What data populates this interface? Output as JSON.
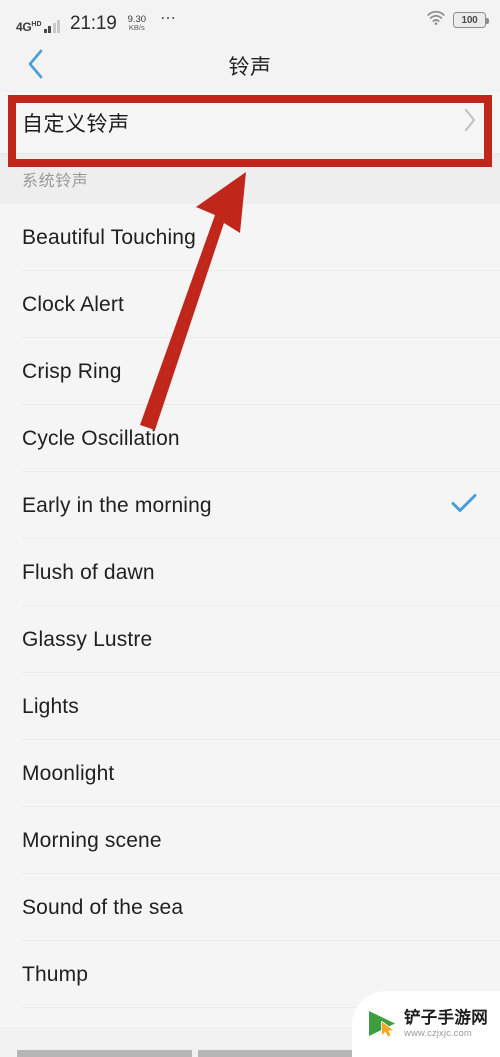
{
  "status_bar": {
    "network_type": "4G",
    "network_hd": "HD",
    "time": "21:19",
    "net_speed_value": "9.30",
    "net_speed_unit": "KB/s",
    "overflow_icon": "more-dots-icon",
    "wifi_icon": "wifi-icon",
    "battery_level": "100"
  },
  "header": {
    "back_icon": "chevron-left-icon",
    "title": "铃声"
  },
  "custom_ringtone": {
    "label": "自定义铃声",
    "chevron_icon": "chevron-right-icon"
  },
  "section": {
    "title": "系统铃声"
  },
  "ringtones": [
    {
      "name": "Beautiful Touching",
      "selected": false
    },
    {
      "name": "Clock Alert",
      "selected": false
    },
    {
      "name": "Crisp Ring",
      "selected": false
    },
    {
      "name": "Cycle Oscillation",
      "selected": false
    },
    {
      "name": "Early in the morning",
      "selected": true
    },
    {
      "name": "Flush of dawn",
      "selected": false
    },
    {
      "name": "Glassy Lustre",
      "selected": false
    },
    {
      "name": "Lights",
      "selected": false
    },
    {
      "name": "Moonlight",
      "selected": false
    },
    {
      "name": "Morning scene",
      "selected": false
    },
    {
      "name": "Sound of the sea",
      "selected": false
    },
    {
      "name": "Thump",
      "selected": false
    }
  ],
  "annotations": {
    "highlight_box_color": "#c0271a",
    "arrow_color": "#c0271a",
    "arrow_description": "arrow pointing to custom ringtone row"
  },
  "watermark": {
    "title": "铲子手游网",
    "url": "www.czjxjc.com",
    "icon": "play-cursor-icon",
    "icon_color": "#3c9e3f"
  },
  "colors": {
    "accent_blue": "#4a9ed8",
    "list_bg": "#f5f5f5",
    "section_bg": "#eeeeee",
    "text_primary": "#1f1f1f",
    "text_muted": "#9a9a9a"
  }
}
